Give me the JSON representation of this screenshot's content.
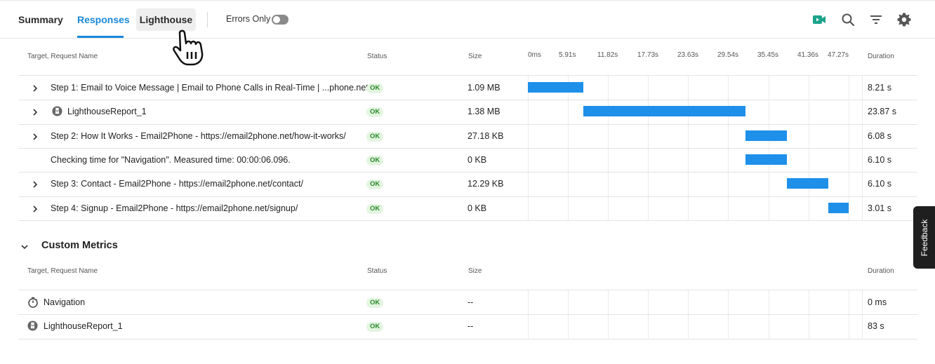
{
  "tabs": {
    "summary": "Summary",
    "responses": "Responses",
    "lighthouse": "Lighthouse"
  },
  "toolbar": {
    "errors_only_label": "Errors Only",
    "errors_only_on": false,
    "icons": [
      "video-icon",
      "search-icon",
      "filter-icon",
      "gear-icon"
    ],
    "video_color": "#1aa38a"
  },
  "responses_table": {
    "headers": {
      "name": "Target, Request Name",
      "status": "Status",
      "size": "Size",
      "duration": "Duration"
    },
    "timeline_ticks": [
      "0ms",
      "5.91s",
      "11.82s",
      "17.73s",
      "23.63s",
      "29.54s",
      "35.45s",
      "41.36s",
      "47.27s"
    ],
    "timeline_max_s": 53.18,
    "rows": [
      {
        "name": "Step 1: Email to Voice Message | Email to Phone Calls in Real-Time | ...phone.net/",
        "status": "OK",
        "size": "1.09 MB",
        "duration": "8.21 s",
        "expandable": true,
        "icon": "",
        "start_s": 0,
        "end_s": 8.21
      },
      {
        "name": "LighthouseReport_1",
        "status": "OK",
        "size": "1.38 MB",
        "duration": "23.87 s",
        "expandable": true,
        "icon": "lighthouse-icon",
        "start_s": 8.21,
        "end_s": 32.08
      },
      {
        "name": "Step 2: How It Works - Email2Phone - https://email2phone.net/how-it-works/",
        "status": "OK",
        "size": "27.18 KB",
        "duration": "6.08 s",
        "expandable": true,
        "icon": "",
        "start_s": 32.08,
        "end_s": 38.16
      },
      {
        "name": "Checking time for \"Navigation\". Measured time: 00:00:06.096.",
        "status": "OK",
        "size": "0 KB",
        "duration": "6.10 s",
        "expandable": false,
        "icon": "",
        "start_s": 32.08,
        "end_s": 38.18
      },
      {
        "name": "Step 3: Contact - Email2Phone - https://email2phone.net/contact/",
        "status": "OK",
        "size": "12.29 KB",
        "duration": "6.10 s",
        "expandable": true,
        "icon": "",
        "start_s": 38.18,
        "end_s": 44.28
      },
      {
        "name": "Step 4: Signup - Email2Phone - https://email2phone.net/signup/",
        "status": "OK",
        "size": "0 KB",
        "duration": "3.01 s",
        "expandable": true,
        "icon": "",
        "start_s": 44.28,
        "end_s": 47.29
      }
    ]
  },
  "custom_metrics": {
    "title": "Custom Metrics",
    "headers": {
      "name": "Target, Request Name",
      "status": "Status",
      "size": "Size",
      "duration": "Duration"
    },
    "rows": [
      {
        "name": "Navigation",
        "status": "OK",
        "size": "--",
        "duration": "0 ms",
        "icon": "stopwatch-icon"
      },
      {
        "name": "LighthouseReport_1",
        "status": "OK",
        "size": "--",
        "duration": "83 s",
        "icon": "lighthouse-icon"
      }
    ]
  },
  "feedback_label": "Feedback",
  "colors": {
    "accent": "#1a88d8",
    "bar": "#1e90ea",
    "ok_bg": "#e3f5e1",
    "ok_text": "#2a8a2a"
  }
}
